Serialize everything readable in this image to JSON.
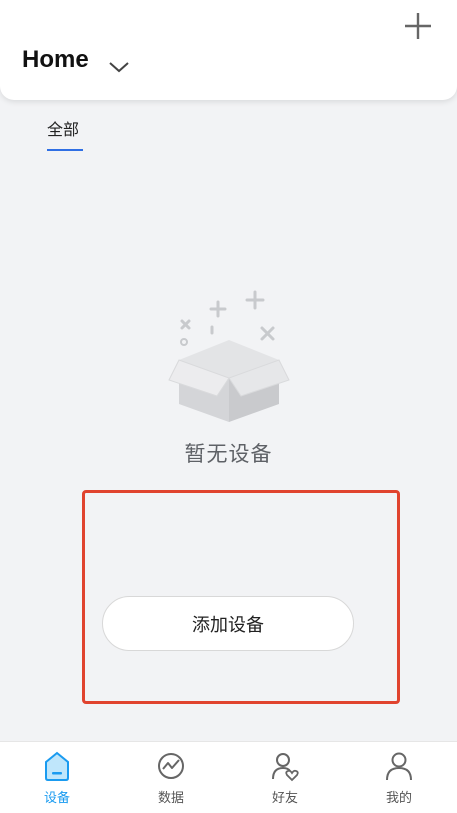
{
  "header": {
    "title": "Home",
    "chevron_icon": "chevron-down-icon",
    "add_icon": "plus-icon"
  },
  "tabs": [
    {
      "label": "全部",
      "active": true
    }
  ],
  "empty_state": {
    "icon": "empty-box-icon",
    "text": "暂无设备"
  },
  "add_device_button": {
    "label": "添加设备"
  },
  "bottom_nav": {
    "items": [
      {
        "label": "设备",
        "icon": "home-device-icon",
        "active": true
      },
      {
        "label": "数据",
        "icon": "data-chart-icon",
        "active": false
      },
      {
        "label": "好友",
        "icon": "friends-icon",
        "active": false
      },
      {
        "label": "我的",
        "icon": "profile-icon",
        "active": false
      }
    ]
  },
  "colors": {
    "accent": "#1a9bf0",
    "tab_underline": "#2f6fe4",
    "highlight_box": "#e0432e",
    "background": "#f2f3f5"
  }
}
